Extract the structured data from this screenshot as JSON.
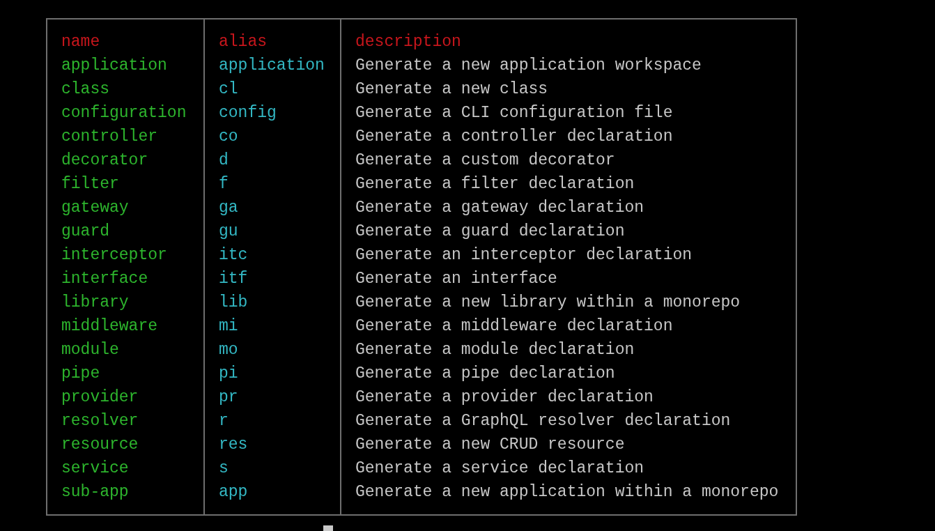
{
  "table": {
    "columns": [
      {
        "label": "name"
      },
      {
        "label": "alias"
      },
      {
        "label": "description"
      }
    ],
    "rows": [
      {
        "name": "application",
        "alias": "application",
        "description": "Generate a new application workspace"
      },
      {
        "name": "class",
        "alias": "cl",
        "description": "Generate a new class"
      },
      {
        "name": "configuration",
        "alias": "config",
        "description": "Generate a CLI configuration file"
      },
      {
        "name": "controller",
        "alias": "co",
        "description": "Generate a controller declaration"
      },
      {
        "name": "decorator",
        "alias": "d",
        "description": "Generate a custom decorator"
      },
      {
        "name": "filter",
        "alias": "f",
        "description": "Generate a filter declaration"
      },
      {
        "name": "gateway",
        "alias": "ga",
        "description": "Generate a gateway declaration"
      },
      {
        "name": "guard",
        "alias": "gu",
        "description": "Generate a guard declaration"
      },
      {
        "name": "interceptor",
        "alias": "itc",
        "description": "Generate an interceptor declaration"
      },
      {
        "name": "interface",
        "alias": "itf",
        "description": "Generate an interface"
      },
      {
        "name": "library",
        "alias": "lib",
        "description": "Generate a new library within a monorepo"
      },
      {
        "name": "middleware",
        "alias": "mi",
        "description": "Generate a middleware declaration"
      },
      {
        "name": "module",
        "alias": "mo",
        "description": "Generate a module declaration"
      },
      {
        "name": "pipe",
        "alias": "pi",
        "description": "Generate a pipe declaration"
      },
      {
        "name": "provider",
        "alias": "pr",
        "description": "Generate a provider declaration"
      },
      {
        "name": "resolver",
        "alias": "r",
        "description": "Generate a GraphQL resolver declaration"
      },
      {
        "name": "resource",
        "alias": "res",
        "description": "Generate a new CRUD resource"
      },
      {
        "name": "service",
        "alias": "s",
        "description": "Generate a service declaration"
      },
      {
        "name": "sub-app",
        "alias": "app",
        "description": "Generate a new application within a monorepo"
      }
    ]
  }
}
